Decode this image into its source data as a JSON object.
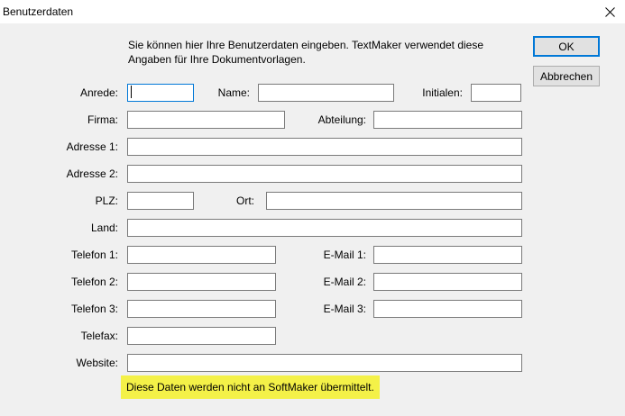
{
  "window": {
    "title": "Benutzerdaten",
    "close_icon": "close-icon"
  },
  "intro_text": "Sie können hier Ihre Benutzerdaten eingeben. TextMaker verwendet diese Angaben für Ihre Dokumentvorlagen.",
  "buttons": {
    "ok": "OK",
    "cancel": "Abbrechen"
  },
  "labels": {
    "anrede": "Anrede:",
    "name": "Name:",
    "initialen": "Initialen:",
    "firma": "Firma:",
    "abteilung": "Abteilung:",
    "adresse1": "Adresse 1:",
    "adresse2": "Adresse 2:",
    "plz": "PLZ:",
    "ort": "Ort:",
    "land": "Land:",
    "telefon1": "Telefon 1:",
    "telefon2": "Telefon 2:",
    "telefon3": "Telefon 3:",
    "email1": "E-Mail 1:",
    "email2": "E-Mail 2:",
    "email3": "E-Mail 3:",
    "telefax": "Telefax:",
    "website": "Website:"
  },
  "values": {
    "anrede": "",
    "name": "",
    "initialen": "",
    "firma": "",
    "abteilung": "",
    "adresse1": "",
    "adresse2": "",
    "plz": "",
    "ort": "",
    "land": "",
    "telefon1": "",
    "telefon2": "",
    "telefon3": "",
    "email1": "",
    "email2": "",
    "email3": "",
    "telefax": "",
    "website": ""
  },
  "note": "Diese Daten werden nicht an SoftMaker übermittelt.",
  "colors": {
    "accent": "#0078d7",
    "note_highlight": "#f4f148",
    "dialog_bg": "#f0f0f0"
  }
}
